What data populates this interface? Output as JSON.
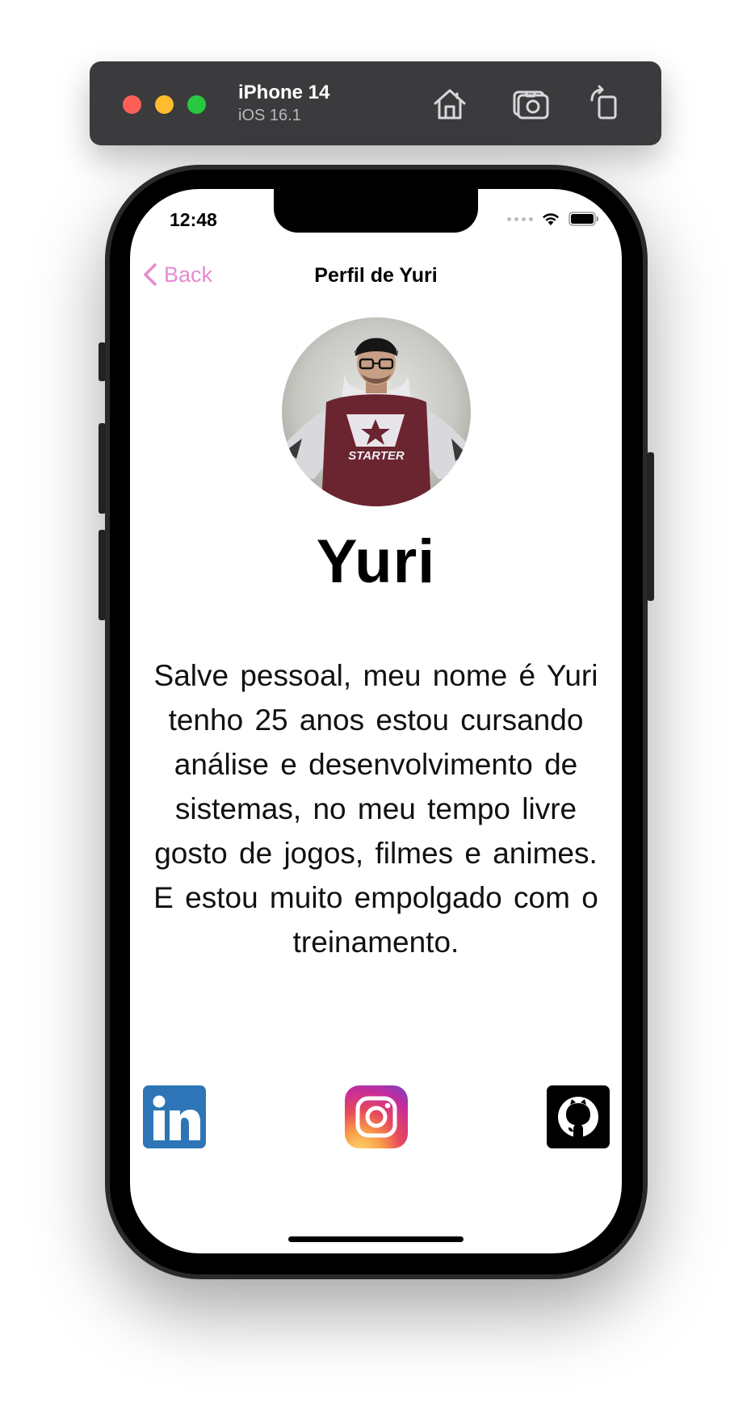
{
  "simulator": {
    "device_name": "iPhone 14",
    "os_version": "iOS 16.1",
    "icons": [
      "home-icon",
      "screenshot-icon",
      "rotate-icon"
    ]
  },
  "status_bar": {
    "time": "12:48",
    "icons": [
      "signal-icon",
      "wifi-icon",
      "battery-icon"
    ]
  },
  "nav": {
    "back_label": "Back",
    "title": "Perfil de Yuri",
    "accent_color": "#e68bd0"
  },
  "profile": {
    "name": "Yuri",
    "bio": "Salve pessoal, meu nome é Yuri tenho 25 anos estou cursando análise e desenvolvimento de sistemas, no meu tempo livre gosto de jogos, filmes e animes. E estou muito empolgado com o treinamento.",
    "shirt_text": "STARTER"
  },
  "social": [
    {
      "name": "linkedin",
      "color": "#2d75b6"
    },
    {
      "name": "instagram",
      "color": "#d6249f"
    },
    {
      "name": "github",
      "color": "#000000"
    }
  ]
}
